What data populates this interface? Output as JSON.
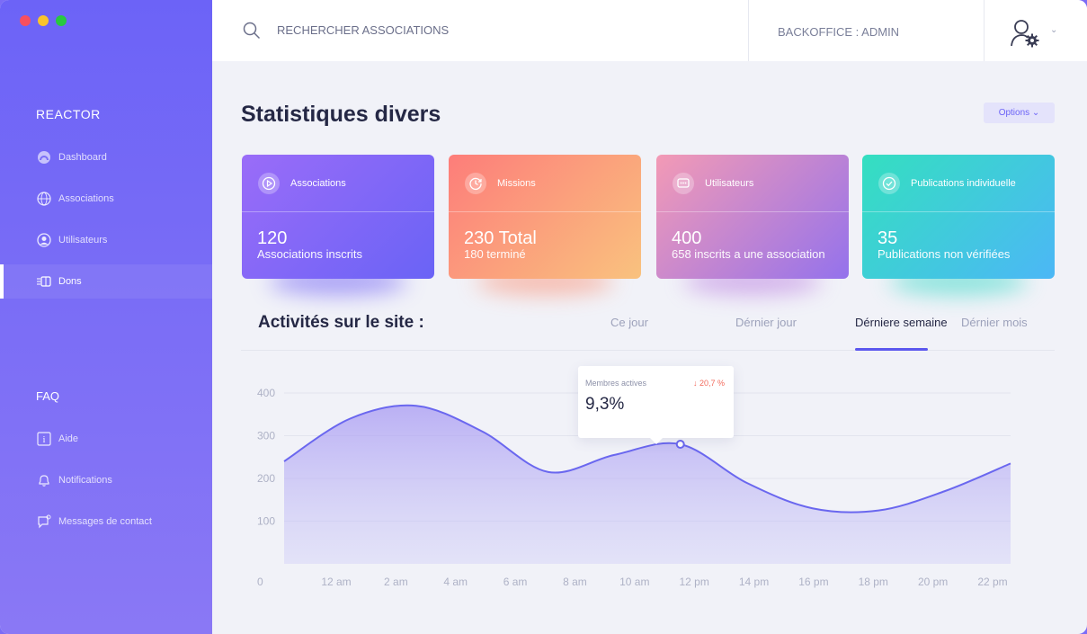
{
  "window": {
    "dots": [
      "#f94f5f",
      "#f9c42c",
      "#28c840"
    ]
  },
  "sidebar": {
    "brand": "REACTOR",
    "items": [
      {
        "label": "Dashboard",
        "icon": "dashboard-icon"
      },
      {
        "label": "Associations",
        "icon": "globe-icon"
      },
      {
        "label": "Utilisateurs",
        "icon": "user-icon"
      },
      {
        "label": "Dons",
        "icon": "donation-icon",
        "active": true
      }
    ],
    "section2": "FAQ",
    "items2": [
      {
        "label": "Aide",
        "icon": "info-icon"
      },
      {
        "label": "Notifications",
        "icon": "bell-icon"
      },
      {
        "label": "Messages de contact",
        "icon": "message-icon"
      }
    ]
  },
  "header": {
    "search_placeholder": "RECHERCHER ASSOCIATIONS",
    "backoffice": "BACKOFFICE : ADMIN"
  },
  "page": {
    "title": "Statistiques divers",
    "options": "Options ⌄"
  },
  "cards": [
    {
      "label": "Associations",
      "value": "120",
      "sub": "Associations inscrits",
      "icon": "play-circle-icon",
      "colors": [
        "#9a6cf8",
        "#6a63f6"
      ],
      "shadow": "#6d5cf5"
    },
    {
      "label": "Missions",
      "value": "230 Total",
      "sub": "180 terminé",
      "icon": "clock-icon",
      "colors": [
        "#fd7d7a",
        "#f9c27e"
      ],
      "shadow": "#fb8f73"
    },
    {
      "label": "Utilisateurs",
      "value": "400",
      "sub": "658 inscrits a une association",
      "icon": "chat-icon",
      "colors": [
        "#f39ab5",
        "#9472ec"
      ],
      "shadow": "#b97be0"
    },
    {
      "label": "Publications individuelle",
      "value": "35",
      "sub": "Publications non vérifiées",
      "icon": "check-circle-icon",
      "colors": [
        "#34dfc0",
        "#4cb7f6"
      ],
      "shadow": "#34d8c6"
    }
  ],
  "activity": {
    "title": "Activités sur le site :",
    "tabs": [
      "Ce jour",
      "Dérnier jour",
      "Dérniere semaine",
      "Dérnier mois"
    ],
    "active_tab": 2,
    "tooltip": {
      "label": "Membres actives",
      "change": "↓ 20,7 %",
      "value": "9,3%"
    }
  },
  "chart_data": {
    "type": "area",
    "x": [
      "12 am",
      "2 am",
      "4 am",
      "6 am",
      "8 am",
      "10 am",
      "12 pm",
      "14 pm",
      "16 pm",
      "18 pm",
      "20 pm",
      "22 pm"
    ],
    "series": [
      {
        "values": [
          240,
          340,
          370,
          310,
          215,
          255,
          280,
          190,
          130,
          125,
          170,
          235
        ]
      }
    ],
    "y_ticks": [
      0,
      100,
      200,
      300,
      400
    ],
    "ylim": [
      0,
      400
    ],
    "grid": true,
    "highlight": {
      "x": "12 pm",
      "value": 280
    },
    "colors": {
      "line": "#6a67ef",
      "fill": "#a89af3"
    }
  }
}
